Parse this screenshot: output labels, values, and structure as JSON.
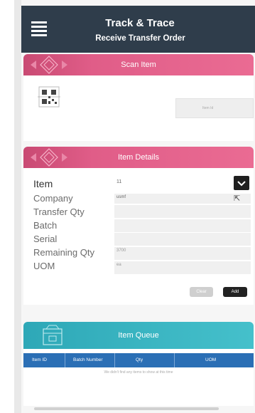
{
  "header": {
    "title": "Track & Trace",
    "subtitle": "Receive Transfer Order"
  },
  "scan_item": {
    "label": "Scan Item",
    "item_id_placeholder": "Item Id"
  },
  "item_details": {
    "label": "Item Details",
    "rows": [
      {
        "label": "Item",
        "value": "11"
      },
      {
        "label": "Company",
        "value": "usmf"
      },
      {
        "label": "Transfer Qty",
        "value": ""
      },
      {
        "label": "Batch",
        "value": ""
      },
      {
        "label": "Serial",
        "value": ""
      },
      {
        "label": "Remaining Qty",
        "value": "3700"
      },
      {
        "label": "UOM",
        "value": "ea"
      }
    ],
    "clear_label": "Clear",
    "add_label": "Add"
  },
  "item_queue": {
    "label": "Item Queue",
    "columns": [
      "Item ID",
      "Batch Number",
      "Qty",
      "UOM"
    ],
    "empty_message": "We didn't find any items to show at this time"
  },
  "colors": {
    "header_bg": "#2f3d4b",
    "pink_band": "#e05d88",
    "teal_band": "#45c0cb",
    "table_header": "#2b6fb5"
  }
}
